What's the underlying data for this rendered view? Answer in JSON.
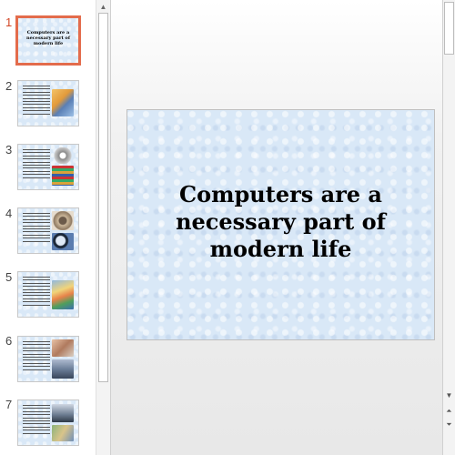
{
  "thumbnails": [
    {
      "number": "1",
      "title": "Computers are a necessary part of modern life"
    },
    {
      "number": "2"
    },
    {
      "number": "3"
    },
    {
      "number": "4"
    },
    {
      "number": "5"
    },
    {
      "number": "6"
    },
    {
      "number": "7"
    }
  ],
  "main_slide": {
    "title": "Computers are a necessary part of modern life"
  },
  "icons": {
    "scroll_up": "triangle-up",
    "scroll_down": "triangle-down",
    "prev_slide": "double-chevron-up",
    "next_slide": "double-chevron-down"
  },
  "colors": {
    "active_thumb_border": "#e36c4c",
    "active_number": "#d24726",
    "slide_background": "#d9e8f7"
  }
}
